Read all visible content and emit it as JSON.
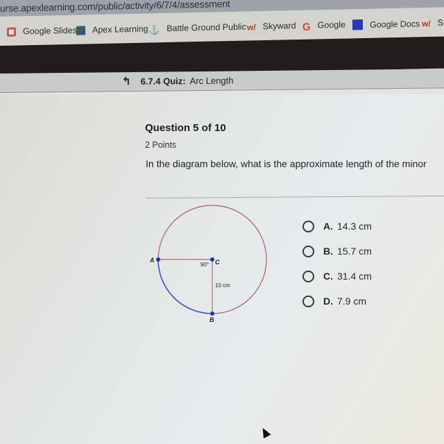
{
  "browser": {
    "url": "urse.apexlearning.com/public/activity/6/7/4/assessment",
    "bookmarks": [
      {
        "label": "Google Slides",
        "icon": "google-slides-icon"
      },
      {
        "label": "Apex Learning",
        "icon": "apex-learning-icon"
      },
      {
        "label": "Battle Ground Public",
        "icon": "battle-ground-icon"
      },
      {
        "label": "Skyward",
        "icon": "skyward-icon"
      },
      {
        "label": "Google",
        "icon": "google-icon"
      },
      {
        "label": "Google Docs",
        "icon": "google-docs-icon"
      },
      {
        "label": "S",
        "icon": "skyward-icon"
      }
    ]
  },
  "breadcrumb": {
    "icon": "up-arrow-icon",
    "number": "6.7.4 Quiz:",
    "title": "Arc Length"
  },
  "question": {
    "title": "Question 5 of 10",
    "points": "2 Points",
    "text": "In the diagram below, what is the approximate length of the minor"
  },
  "diagram": {
    "labels": {
      "a": "A",
      "b": "B",
      "c": "C",
      "angle": "90°",
      "radius": "10 cm"
    },
    "colors": {
      "circle": "#b85a5a",
      "minor_arc": "#3a52c8",
      "point": "#1c2fbf",
      "radius_line": "#b98080"
    }
  },
  "choices": [
    {
      "letter": "A.",
      "value": "14.3 cm"
    },
    {
      "letter": "B.",
      "value": "15.7 cm"
    },
    {
      "letter": "C.",
      "value": "31.4 cm"
    },
    {
      "letter": "D.",
      "value": "7.9 cm"
    }
  ]
}
